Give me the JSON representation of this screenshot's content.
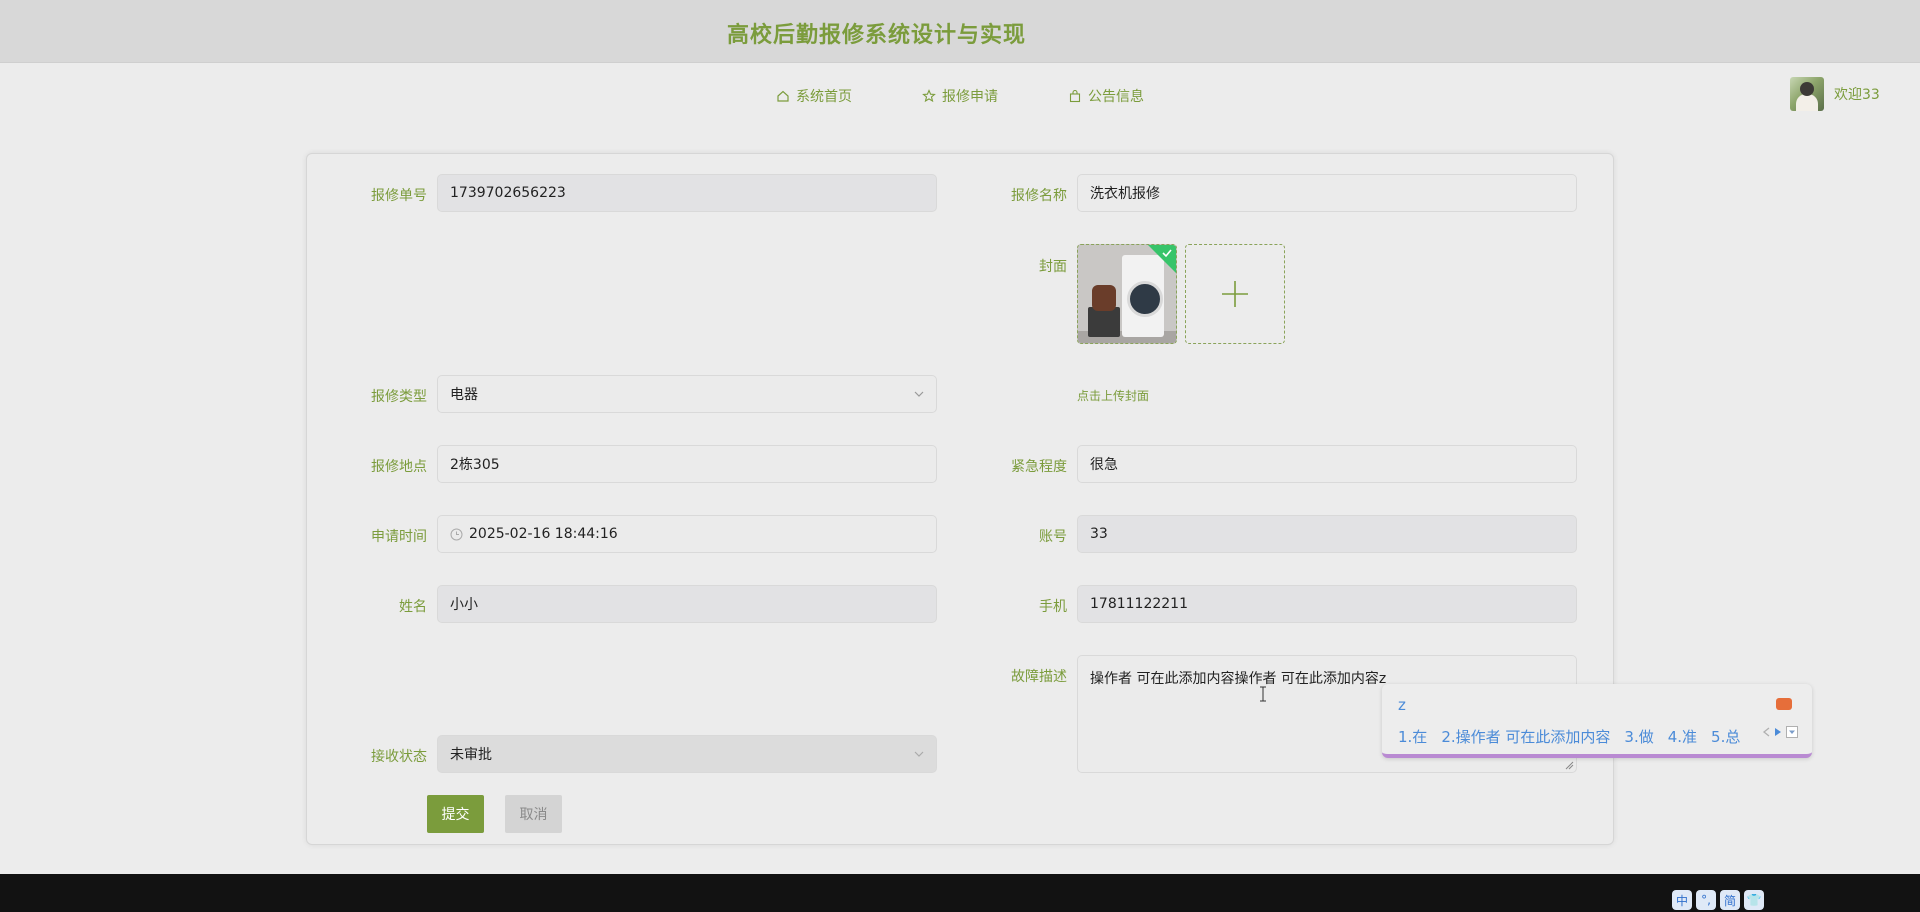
{
  "header": {
    "title": "高校后勤报修系统设计与实现"
  },
  "nav": {
    "items": [
      {
        "label": "系统首页",
        "icon": "home-icon"
      },
      {
        "label": "报修申请",
        "icon": "star-icon"
      },
      {
        "label": "公告信息",
        "icon": "bag-icon"
      }
    ]
  },
  "user": {
    "welcome": "欢迎33"
  },
  "form": {
    "order_no": {
      "label": "报修单号",
      "value": "1739702656223"
    },
    "repair_name": {
      "label": "报修名称",
      "value": "洗衣机报修"
    },
    "cover": {
      "label": "封面",
      "hint": "点击上传封面"
    },
    "repair_type": {
      "label": "报修类型",
      "value": "电器"
    },
    "location": {
      "label": "报修地点",
      "value": "2栋305"
    },
    "urgency": {
      "label": "紧急程度",
      "value": "很急"
    },
    "apply_time": {
      "label": "申请时间",
      "value": "2025-02-16 18:44:16"
    },
    "account": {
      "label": "账号",
      "value": "33"
    },
    "name": {
      "label": "姓名",
      "value": "小小"
    },
    "phone": {
      "label": "手机",
      "value": "17811122211"
    },
    "fault": {
      "label": "故障描述",
      "value": "操作者  可在此添加内容操作者  可在此添加内容z"
    },
    "receive_status": {
      "label": "接收状态",
      "value": "未审批"
    },
    "submit_label": "提交",
    "cancel_label": "取消"
  },
  "ime": {
    "input": "z",
    "candidates": [
      "1.在",
      "2.操作者  可在此添加内容",
      "3.做",
      "4.准",
      "5.总"
    ]
  },
  "tray": [
    "中",
    "°,",
    "简",
    "👕"
  ],
  "colors": {
    "accent": "#7b9c3c",
    "footer": "#121212",
    "topbar": "#d8d8d8"
  }
}
